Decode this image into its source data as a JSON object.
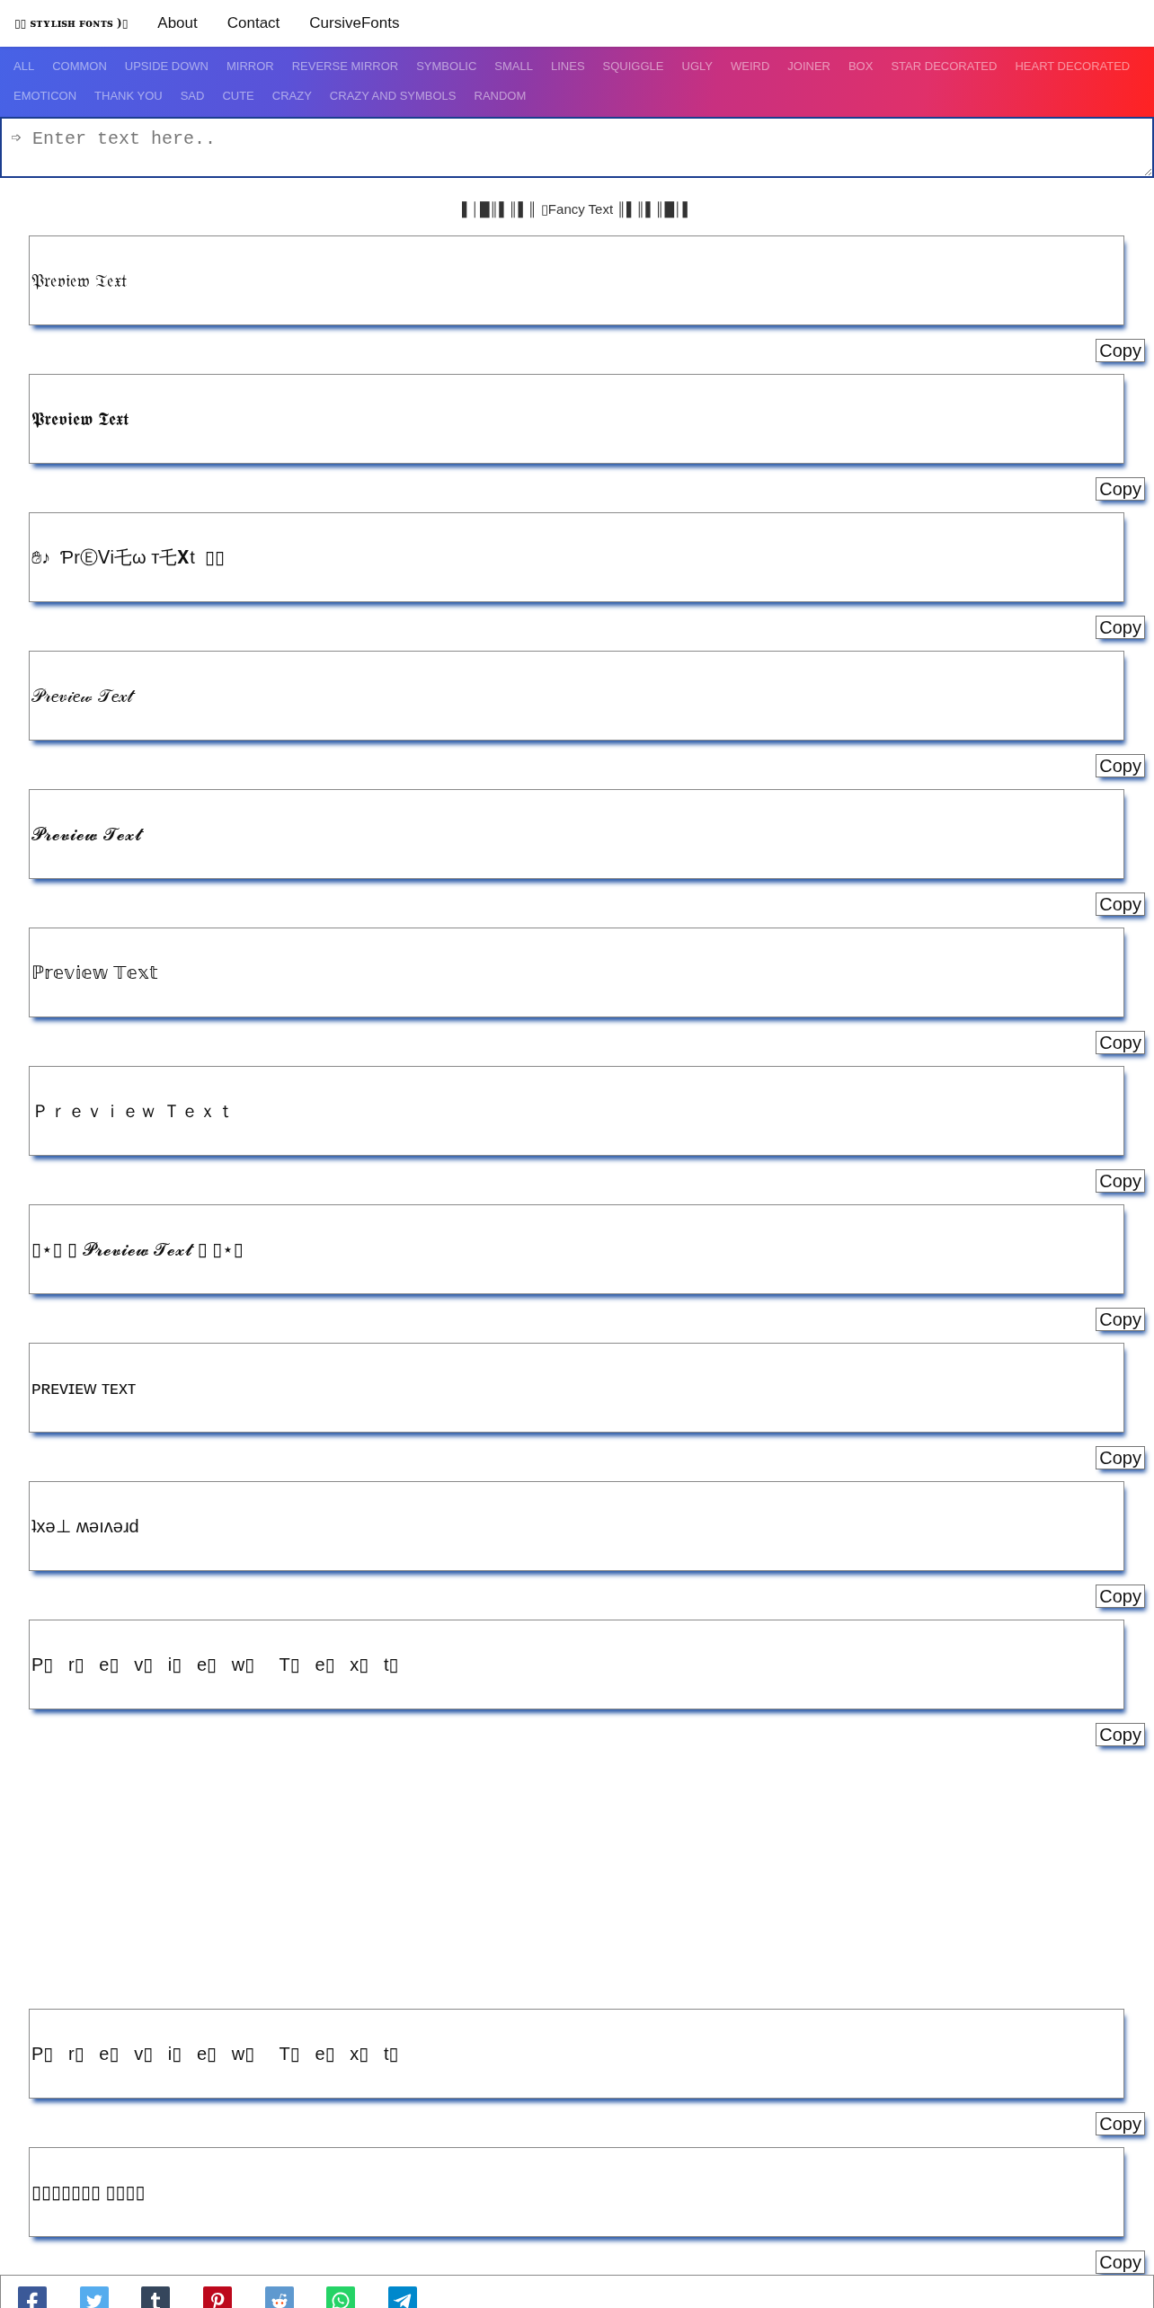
{
  "nav": {
    "logo": "▯▯ ꜱᴛʏʟɪꜱʜ ꜰᴏɴᴛꜱ )▯",
    "links": [
      "About",
      "Contact",
      "CursiveFonts"
    ]
  },
  "categories": [
    "ALL",
    "COMMON",
    "UPSIDE DOWN",
    "MIRROR",
    "REVERSE MIRROR",
    "SYMBOLIC",
    "SMALL",
    "LINES",
    "SQUIGGLE",
    "UGLY",
    "WEIRD",
    "JOINER",
    "BOX",
    "STAR DECORATED",
    "HEART DECORATED",
    "EMOTICON",
    "THANK YOU",
    "SAD",
    "CUTE",
    "CRAZY",
    "CRAZY AND SYMBOLS",
    "RANDOM"
  ],
  "input": {
    "placeholder": "➩ Enter text here.."
  },
  "heading": "▌│█║▌║▌║ ▯Fancy Text ║▌║▌║█│▌",
  "sections": [
    {
      "previews": [
        {
          "text": "𝔓𝔯𝔢𝔳𝔦𝔢𝔴 𝔗𝔢𝔵𝔱",
          "button": "Copy"
        },
        {
          "text": "𝕻𝖗𝖊𝖛𝖎𝖊𝖜 𝕿𝖊𝖝𝖙",
          "button": "Copy"
        },
        {
          "text": "✋♪  ƤrⒺᐯi乇ω т乇𝐗t  ▯▯",
          "button": "Copy"
        },
        {
          "text": "𝒫𝓇𝑒𝓋𝒾𝑒𝓌 𝒯𝑒𝓍𝓉",
          "button": "Copy"
        },
        {
          "text": "𝓟𝓻𝓮𝓿𝓲𝓮𝔀 𝓣𝓮𝔁𝓽",
          "button": "Copy"
        },
        {
          "text": "ℙ𝕣𝕖𝕧𝕚𝕖𝕨 𝕋𝕖𝕩𝕥",
          "button": "Copy"
        },
        {
          "text": "Ｐｒｅｖｉｅｗ Ｔｅｘｔ",
          "button": "Copy"
        },
        {
          "text": "▯⋆▯ ▯ 𝓟𝓻𝓮𝓿𝓲𝓮𝔀 𝓣𝓮𝔁𝓽 ▯ ▯⋆▯",
          "button": "Copy"
        },
        {
          "text": "ᴘʀᴇᴠɪᴇᴡ ᴛᴇxᴛ",
          "button": "Copy"
        },
        {
          "text": "ʇxǝ⊥ ʍǝıʌǝɹd",
          "button": "Copy"
        },
        {
          "text": "P▯   r▯   e▯   v▯   i▯   e▯   w▯     T▯   e▯   x▯   t▯",
          "button": "Copy"
        }
      ]
    },
    {
      "previews": [
        {
          "text": "P▯   r▯   e▯   v▯   i▯   e▯   w▯     T▯   e▯   x▯   t▯",
          "button": "Copy"
        },
        {
          "text": "▯▯▯▯▯▯▯ ▯▯▯▯",
          "button": "Copy"
        }
      ]
    }
  ]
}
